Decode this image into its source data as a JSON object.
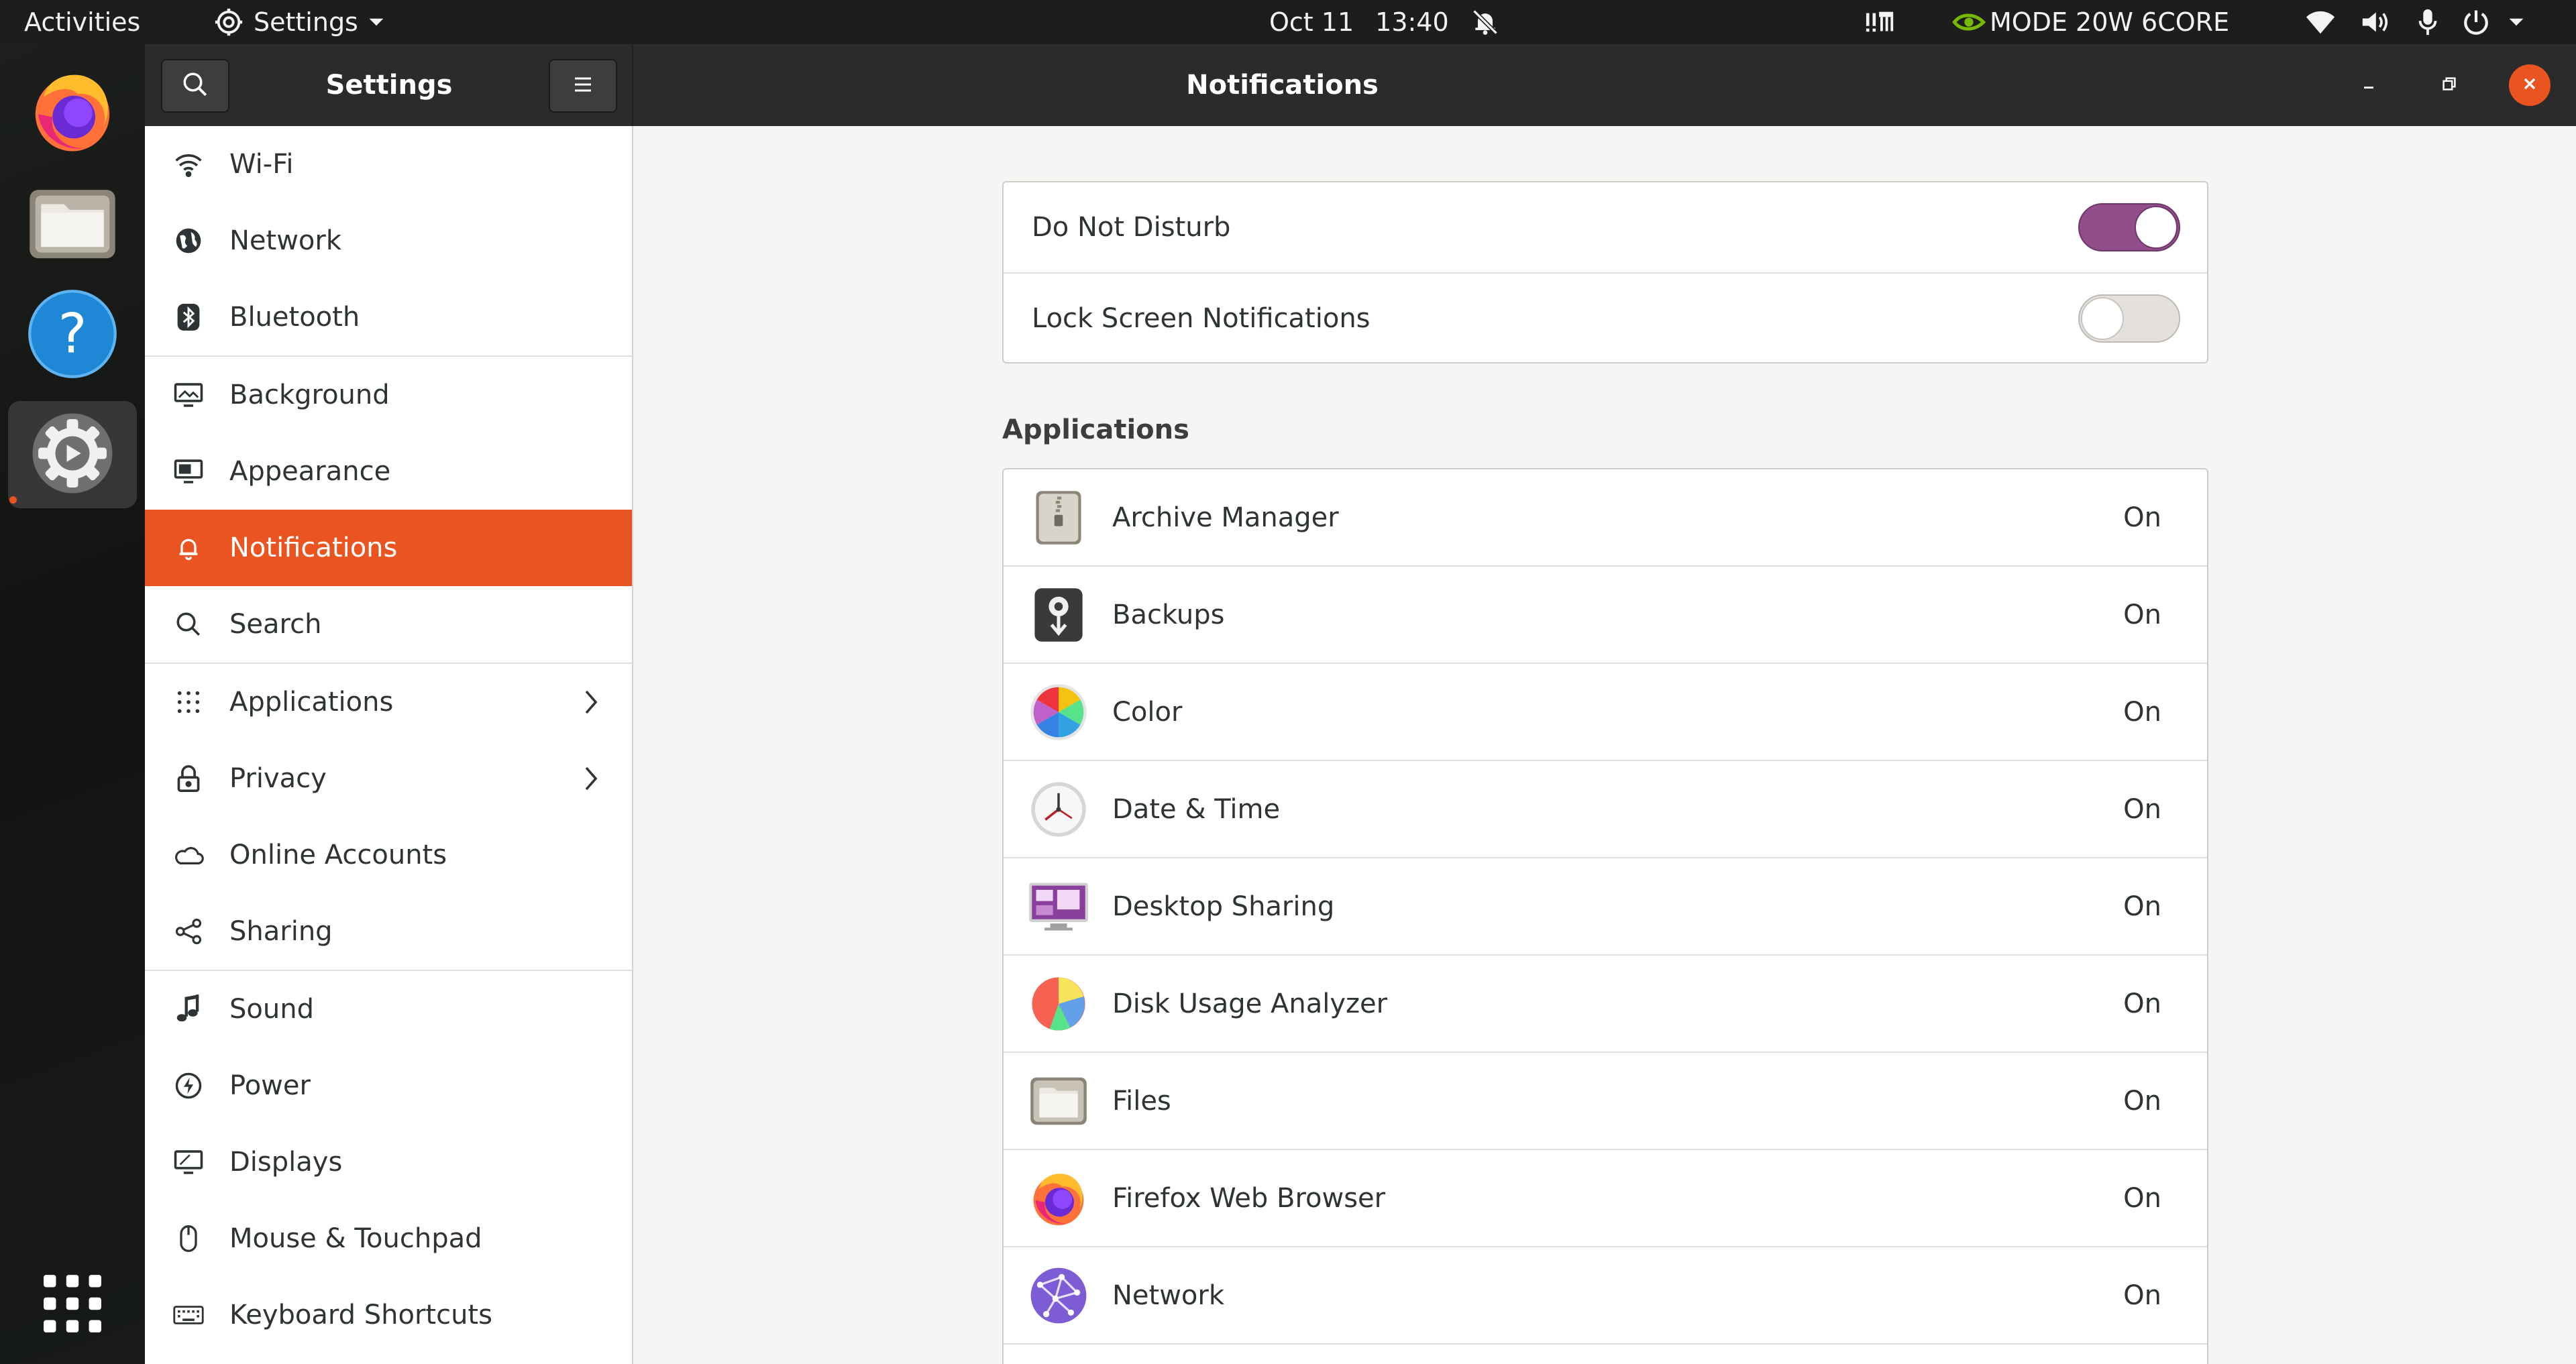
{
  "topbar": {
    "activities": "Activities",
    "app_menu": "Settings",
    "date": "Oct 11",
    "time": "13:40",
    "gpu_mode": "MODE 20W 6CORE"
  },
  "window": {
    "sidebar_title": "Settings",
    "title": "Notifications"
  },
  "dock": {
    "items": [
      {
        "name": "Firefox",
        "icon": "firefox-icon"
      },
      {
        "name": "Files",
        "icon": "files-icon"
      },
      {
        "name": "Help",
        "icon": "help-icon"
      },
      {
        "name": "Settings",
        "icon": "settings-gear-icon",
        "active": true
      }
    ],
    "show_apps_icon": "grid-icon"
  },
  "sidebar": {
    "items": [
      {
        "label": "Wi-Fi",
        "icon": "wifi-icon"
      },
      {
        "label": "Network",
        "icon": "globe-icon"
      },
      {
        "label": "Bluetooth",
        "icon": "bluetooth-icon"
      },
      {
        "label": "Background",
        "icon": "monitor-icon"
      },
      {
        "label": "Appearance",
        "icon": "appearance-icon"
      },
      {
        "label": "Notifications",
        "icon": "bell-icon",
        "selected": true
      },
      {
        "label": "Search",
        "icon": "search-icon"
      },
      {
        "label": "Applications",
        "icon": "apps-grid-icon",
        "chevron": true
      },
      {
        "label": "Privacy",
        "icon": "lock-icon",
        "chevron": true
      },
      {
        "label": "Online Accounts",
        "icon": "cloud-icon"
      },
      {
        "label": "Sharing",
        "icon": "share-icon"
      },
      {
        "label": "Sound",
        "icon": "music-note-icon"
      },
      {
        "label": "Power",
        "icon": "power-icon"
      },
      {
        "label": "Displays",
        "icon": "display-icon"
      },
      {
        "label": "Mouse & Touchpad",
        "icon": "mouse-icon"
      },
      {
        "label": "Keyboard Shortcuts",
        "icon": "keyboard-icon"
      }
    ]
  },
  "notifications": {
    "do_not_disturb": {
      "label": "Do Not Disturb",
      "on": true
    },
    "lock_screen": {
      "label": "Lock Screen Notifications",
      "on": false
    },
    "applications_heading": "Applications",
    "apps": [
      {
        "name": "Archive Manager",
        "state": "On",
        "icon": "archive-manager-icon"
      },
      {
        "name": "Backups",
        "state": "On",
        "icon": "backups-icon"
      },
      {
        "name": "Color",
        "state": "On",
        "icon": "color-icon"
      },
      {
        "name": "Date & Time",
        "state": "On",
        "icon": "clock-icon"
      },
      {
        "name": "Desktop Sharing",
        "state": "On",
        "icon": "desktop-sharing-icon"
      },
      {
        "name": "Disk Usage Analyzer",
        "state": "On",
        "icon": "disk-usage-icon"
      },
      {
        "name": "Files",
        "state": "On",
        "icon": "files-icon"
      },
      {
        "name": "Firefox Web Browser",
        "state": "On",
        "icon": "firefox-icon"
      },
      {
        "name": "Network",
        "state": "On",
        "icon": "network-icon"
      }
    ]
  },
  "colors": {
    "accent": "#e95420",
    "switch_on": "#924d8b",
    "headerbar": "#2b2b2b",
    "topbar": "#1d1d1d"
  }
}
